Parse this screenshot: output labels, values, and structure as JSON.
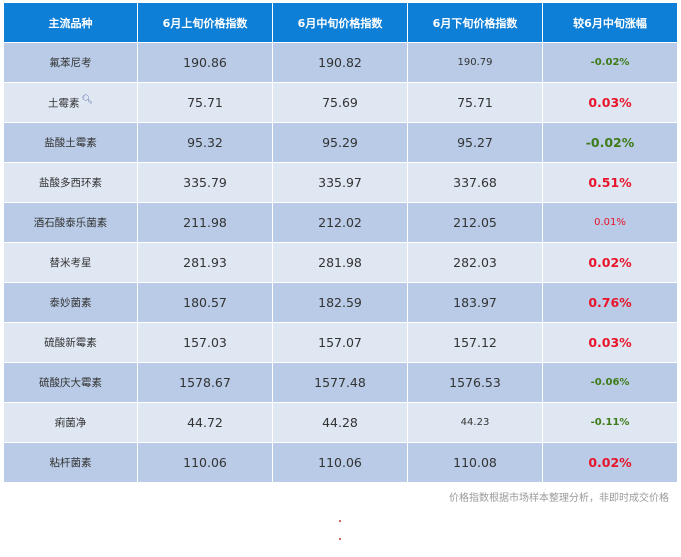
{
  "table": {
    "headers": [
      "主流品种",
      "6月上旬价格指数",
      "6月中旬价格指数",
      "6月下旬价格指数",
      "较6月中旬涨幅"
    ],
    "rows": [
      {
        "name": "氟苯尼考",
        "early": "190.86",
        "mid": "190.82",
        "late": "190.79",
        "change": "-0.02%"
      },
      {
        "name": "土霉素",
        "early": "75.71",
        "mid": "75.69",
        "late": "75.71",
        "change": "0.03%"
      },
      {
        "name": "盐酸土霉素",
        "early": "95.32",
        "mid": "95.29",
        "late": "95.27",
        "change": "-0.02%"
      },
      {
        "name": "盐酸多西环素",
        "early": "335.79",
        "mid": "335.97",
        "late": "337.68",
        "change": "0.51%"
      },
      {
        "name": "酒石酸泰乐菌素",
        "early": "211.98",
        "mid": "212.02",
        "late": "212.05",
        "change": "0.01%"
      },
      {
        "name": "替米考星",
        "early": "281.93",
        "mid": "281.98",
        "late": "282.03",
        "change": "0.02%"
      },
      {
        "name": "泰妙菌素",
        "early": "180.57",
        "mid": "182.59",
        "late": "183.97",
        "change": "0.76%"
      },
      {
        "name": "硫酸新霉素",
        "early": "157.03",
        "mid": "157.07",
        "late": "157.12",
        "change": "0.03%"
      },
      {
        "name": "硫酸庆大霉素",
        "early": "1578.67",
        "mid": "1577.48",
        "late": "1576.53",
        "change": "-0.06%"
      },
      {
        "name": "痢菌净",
        "early": "44.72",
        "mid": "44.28",
        "late": "44.23",
        "change": "-0.11%"
      },
      {
        "name": "粘杆菌素",
        "early": "110.06",
        "mid": "110.06",
        "late": "110.08",
        "change": "0.02%"
      }
    ]
  },
  "footnote": "价格指数根据市场样本整理分析，非即时成交价格",
  "colors": {
    "header_bg": "#0d7fd6",
    "row_odd": "#b9cbe6",
    "row_even": "#dfe7f3",
    "up": "#e8152b",
    "down": "#3e7b19"
  },
  "icons": {
    "search": "magnifier-icon"
  }
}
